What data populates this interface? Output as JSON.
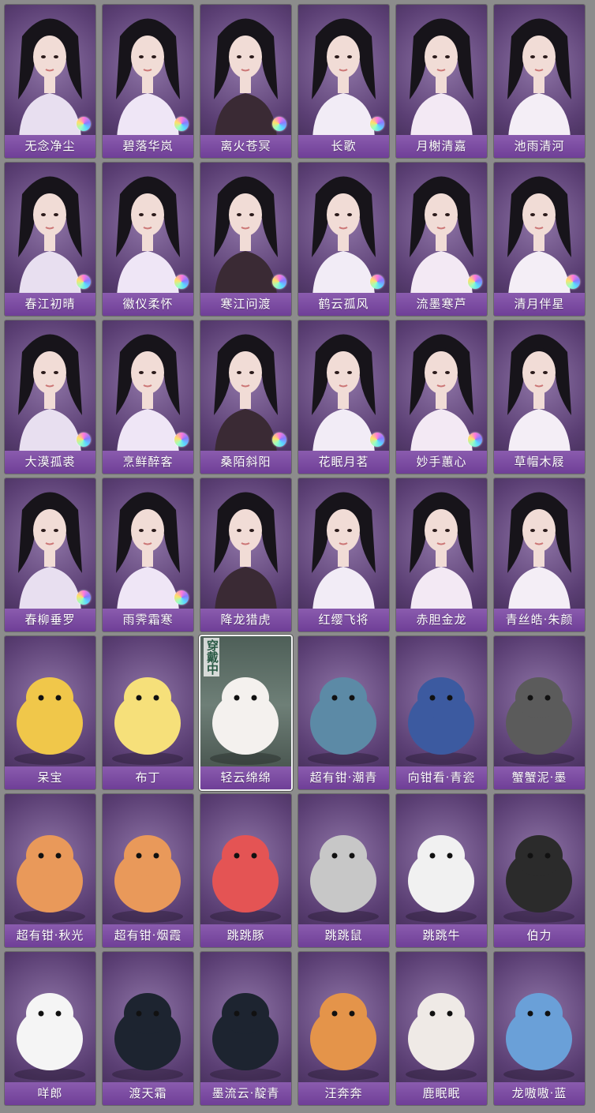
{
  "grid": {
    "columns": 6,
    "rows": 7,
    "wearing_badge": "穿戴中",
    "colors": {
      "page_bg": "#8c8c8c",
      "label_bar": "#7a4aa3",
      "card_purple": "#6b4f86",
      "card_green": "#5a6b62"
    },
    "cards": [
      {
        "name": "无念净尘",
        "kind": "hair",
        "icon": "portrait-dark-hair-icon",
        "badge": true,
        "selected": false
      },
      {
        "name": "碧落华岚",
        "kind": "hair",
        "icon": "portrait-ornate-hair-icon",
        "badge": true,
        "selected": false
      },
      {
        "name": "离火苍冥",
        "kind": "hair",
        "icon": "portrait-red-collar-icon",
        "badge": true,
        "selected": false
      },
      {
        "name": "长歌",
        "kind": "hair",
        "icon": "portrait-updo-icon",
        "badge": true,
        "selected": false
      },
      {
        "name": "月榭清嘉",
        "kind": "hair",
        "icon": "portrait-gold-hairpin-icon",
        "badge": false,
        "selected": false
      },
      {
        "name": "池雨清河",
        "kind": "hair",
        "icon": "portrait-updo-icon",
        "badge": false,
        "selected": false
      },
      {
        "name": "春江初晴",
        "kind": "hair",
        "icon": "portrait-green-flower-icon",
        "badge": true,
        "selected": false
      },
      {
        "name": "徽仪柔怀",
        "kind": "hair",
        "icon": "portrait-bun-icon",
        "badge": true,
        "selected": false
      },
      {
        "name": "寒江问渡",
        "kind": "hair",
        "icon": "portrait-ponytail-icon",
        "badge": true,
        "selected": false
      },
      {
        "name": "鹤云孤风",
        "kind": "hair",
        "icon": "portrait-high-ponytail-icon",
        "badge": true,
        "selected": false
      },
      {
        "name": "流墨寒芦",
        "kind": "hair",
        "icon": "portrait-dark-robe-icon",
        "badge": true,
        "selected": false
      },
      {
        "name": "清月伴星",
        "kind": "hair",
        "icon": "portrait-long-hair-icon",
        "badge": true,
        "selected": false
      },
      {
        "name": "大漠孤裘",
        "kind": "hair",
        "icon": "portrait-headband-icon",
        "badge": true,
        "selected": false
      },
      {
        "name": "烹鲜醉客",
        "kind": "hair",
        "icon": "portrait-braids-icon",
        "badge": true,
        "selected": false
      },
      {
        "name": "桑陌斜阳",
        "kind": "hair",
        "icon": "portrait-red-scarf-icon",
        "badge": true,
        "selected": false
      },
      {
        "name": "花眠月茗",
        "kind": "hair",
        "icon": "portrait-flower-icon",
        "badge": true,
        "selected": false
      },
      {
        "name": "妙手蕙心",
        "kind": "hair",
        "icon": "portrait-green-bow-icon",
        "badge": true,
        "selected": false
      },
      {
        "name": "草帽木屐",
        "kind": "hair",
        "icon": "portrait-straw-hat-icon",
        "badge": false,
        "selected": false
      },
      {
        "name": "春柳垂罗",
        "kind": "hair",
        "icon": "portrait-hair-flower-icon",
        "badge": true,
        "selected": false
      },
      {
        "name": "雨霁霜寒",
        "kind": "hair",
        "icon": "portrait-loose-hair-icon",
        "badge": true,
        "selected": false
      },
      {
        "name": "降龙猎虎",
        "kind": "hair",
        "icon": "portrait-topknot-icon",
        "badge": false,
        "selected": false
      },
      {
        "name": "红缨飞将",
        "kind": "hair",
        "icon": "portrait-helmet-icon",
        "badge": false,
        "selected": false
      },
      {
        "name": "赤胆金龙",
        "kind": "hair",
        "icon": "portrait-dark-armor-icon",
        "badge": false,
        "selected": false
      },
      {
        "name": "青丝皓·朱颜",
        "kind": "hair",
        "icon": "portrait-silver-hair-icon",
        "badge": false,
        "selected": false
      },
      {
        "name": "呆宝",
        "kind": "pet",
        "icon": "yellow-duck-icon",
        "badge": false,
        "selected": false
      },
      {
        "name": "布丁",
        "kind": "pet",
        "icon": "yellow-chick-icon",
        "badge": false,
        "selected": false
      },
      {
        "name": "轻云绵绵",
        "kind": "pet",
        "icon": "white-alpaca-icon",
        "badge": false,
        "selected": true
      },
      {
        "name": "超有钳·潮青",
        "kind": "pet",
        "icon": "crab-leaf-icon",
        "badge": false,
        "selected": false
      },
      {
        "name": "向钳看·青瓷",
        "kind": "pet",
        "icon": "porcelain-crab-icon",
        "badge": false,
        "selected": false
      },
      {
        "name": "蟹蟹泥·墨",
        "kind": "pet",
        "icon": "shell-crab-icon",
        "badge": false,
        "selected": false
      },
      {
        "name": "超有钳·秋光",
        "kind": "pet",
        "icon": "crab-green-leaf-icon",
        "badge": false,
        "selected": false
      },
      {
        "name": "超有钳·烟霞",
        "kind": "pet",
        "icon": "crab-yellow-leaf-icon",
        "badge": false,
        "selected": false
      },
      {
        "name": "跳跳豚",
        "kind": "pet",
        "icon": "pufferfish-icon",
        "badge": false,
        "selected": false
      },
      {
        "name": "跳跳鼠",
        "kind": "pet",
        "icon": "hamster-icon",
        "badge": false,
        "selected": false
      },
      {
        "name": "跳跳牛",
        "kind": "pet",
        "icon": "cow-icon",
        "badge": false,
        "selected": false
      },
      {
        "name": "伯力",
        "kind": "pet",
        "icon": "husky-icon",
        "badge": false,
        "selected": false
      },
      {
        "name": "咩郎",
        "kind": "pet",
        "icon": "white-poodle-icon",
        "badge": false,
        "selected": false
      },
      {
        "name": "渡天霜",
        "kind": "pet",
        "icon": "black-horse-icon",
        "badge": false,
        "selected": false
      },
      {
        "name": "墨流云·靛青",
        "kind": "pet",
        "icon": "blue-mane-horse-icon",
        "badge": false,
        "selected": false
      },
      {
        "name": "汪奔奔",
        "kind": "pet",
        "icon": "corgi-icon",
        "badge": false,
        "selected": false
      },
      {
        "name": "鹿眠眠",
        "kind": "pet",
        "icon": "deer-icon",
        "badge": false,
        "selected": false
      },
      {
        "name": "龙嗷嗷·蓝",
        "kind": "pet",
        "icon": "blue-dragon-icon",
        "badge": false,
        "selected": false
      }
    ]
  }
}
